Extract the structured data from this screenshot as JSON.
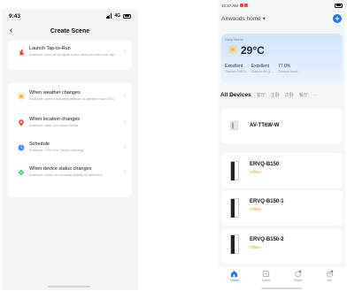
{
  "left": {
    "status": {
      "time": "9:43",
      "network": "4G"
    },
    "header": {
      "back": "‹",
      "title": "Create Scene"
    },
    "tap_to_run": {
      "title": "Launch Tap-to-Run",
      "desc": "Example: turn off all lights in the bedroom with one tap."
    },
    "conditions": [
      {
        "icon": "sun-icon",
        "color": "#f59e0b",
        "title": "When weather changes",
        "desc": "Example: when local temperature is greater than 28°C."
      },
      {
        "icon": "location-pin-icon",
        "color": "#ef4444",
        "title": "When location changes",
        "desc": "Example: after you leave home."
      },
      {
        "icon": "clock-icon",
        "color": "#3b82f6",
        "title": "Schedule",
        "desc": "Example: 7:00 a.m. every morning"
      },
      {
        "icon": "device-icon",
        "color": "#22c55e",
        "title": "When device status changes",
        "desc": "Example: when an unusual activity is detected."
      }
    ]
  },
  "right": {
    "status": {
      "time": "10:37 AM"
    },
    "home_selector": "Airwoods home",
    "weather": {
      "location": "Cozy Home",
      "temperature": "29°C",
      "metrics": [
        {
          "value": "Excellent",
          "label": "Outdoor PM2.5"
        },
        {
          "value": "Excellent",
          "label": "Outdoor Air Q..."
        },
        {
          "value": "77.0%",
          "label": "Outdoor Humi..."
        }
      ]
    },
    "tabs": {
      "active": "All Devices",
      "others": [
        "客厅",
        "主卧",
        "次卧",
        "餐厅"
      ],
      "more": "···"
    },
    "devices": [
      {
        "name": "AV-TT6W-W",
        "status": ""
      },
      {
        "name": "ERVQ-B150",
        "status": "Offline"
      },
      {
        "name": "ERVQ-B150-1",
        "status": "Offline"
      },
      {
        "name": "ERVQ-B150-2",
        "status": "Offline"
      }
    ],
    "nav": [
      "Home",
      "Scene",
      "Smart",
      "Me"
    ]
  }
}
